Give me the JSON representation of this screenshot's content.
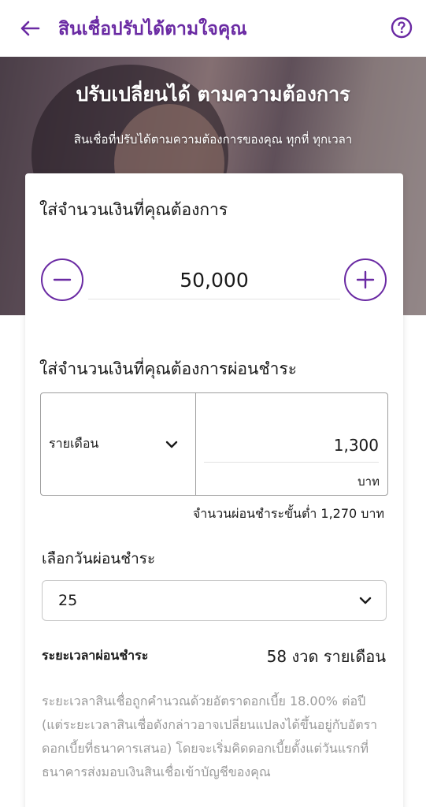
{
  "header": {
    "title": "สินเชื่อปรับได้ตามใจคุณ",
    "back_icon": "arrow-left-icon",
    "help_icon": "question-circle-icon",
    "accent_color": "#6a2aa3"
  },
  "hero": {
    "title": "ปรับเปลี่ยนได้ ตามความต้องการ",
    "subtitle": "สินเชื่อที่ปรับได้ตามความต้องการของคุณ ทุกที่ ทุกเวลา"
  },
  "loan_amount": {
    "label": "ใส่จำนวนเงินที่คุณต้องการ",
    "value": "50,000",
    "minus_icon": "minus-circle-icon",
    "plus_icon": "plus-circle-icon"
  },
  "installment": {
    "label": "ใส่จำนวนเงินที่คุณต้องการผ่อนชำระ",
    "frequency": "รายเดือน",
    "amount": "1,300",
    "unit": "บาท",
    "minimum_note": "จำนวนผ่อนชำระขั้นต่ำ 1,270 บาท"
  },
  "payment_date": {
    "label": "เลือกวันผ่อนชำระ",
    "value": "25"
  },
  "term": {
    "label": "ระยะเวลาผ่อนชำระ",
    "value": "58 งวด รายเดือน"
  },
  "disclaimer": "ระยะเวลาสินเชื่อถูกคำนวณด้วยอัตราดอกเบี้ย 18.00% ต่อปี (แต่ระยะเวลาสินเชื่อดังกล่าวอาจเปลี่ยนแปลงได้ขึ้นอยู่กับอัตราดอกเบี้ยที่ธนาคารเสนอ) โดยจะเริ่มคิดดอกเบี้ยตั้งแต่วันแรกที่ธนาคารส่งมอบเงินสินเชื่อเข้าบัญชีของคุณ"
}
